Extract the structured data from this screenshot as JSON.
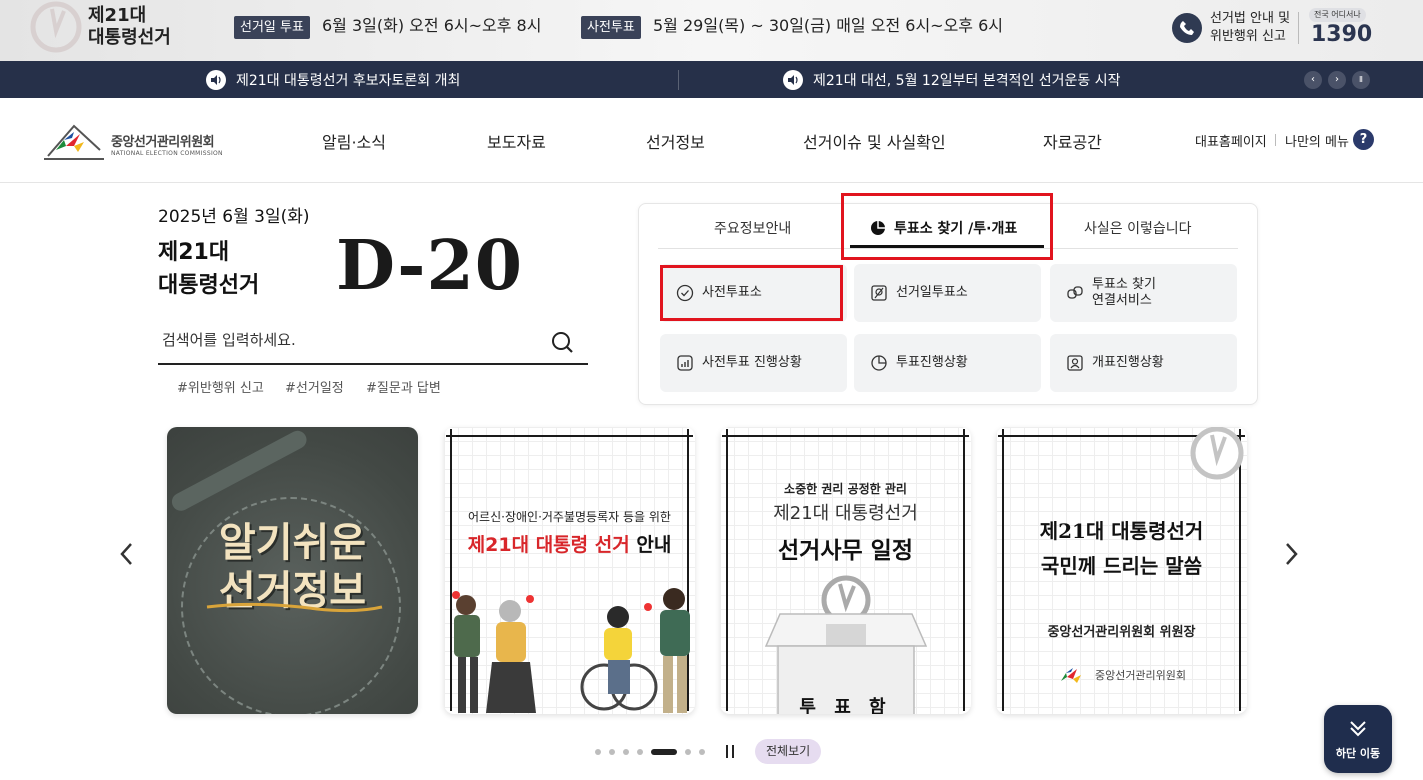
{
  "election_banner": {
    "title_line1": "제21대",
    "title_line2": "대통령선거",
    "election_day_tag": "선거일 투표",
    "election_day_date": "6월 3일(화) 오전 6시~오후 8시",
    "early_vote_tag": "사전투표",
    "early_vote_date": "5월 29일(목) ~ 30일(금) 매일 오전 6시~오후 6시",
    "law_guide_line1": "선거법 안내 및",
    "law_guide_line2": "위반행위 신고",
    "hotline_badge": "전국 어디서나",
    "hotline_number": "1390"
  },
  "ticker": {
    "items": [
      "제21대 대통령선거 후보자토론회 개최",
      "제21대 대선, 5월 12일부터 본격적인 선거운동 시작"
    ],
    "prev": "‹",
    "next": "›",
    "pause": "Ⅱ"
  },
  "header": {
    "logo_name": "중앙선거관리위원회",
    "logo_en": "NATIONAL ELECTION COMMISSION",
    "nav": [
      "알림·소식",
      "보도자료",
      "선거정보",
      "선거이슈 및 사실확인",
      "자료공간"
    ],
    "util_home": "대표홈페이지",
    "util_menu": "나만의 메뉴",
    "help": "?"
  },
  "hero": {
    "date": "2025년 6월 3일(화)",
    "title_line1": "제21대",
    "title_line2": "대통령선거",
    "dday": "D-20",
    "search_placeholder": "검색어를 입력하세요.",
    "tags": [
      "#위반행위 신고",
      "#선거일정",
      "#질문과 답변"
    ]
  },
  "panel": {
    "tabs": [
      "주요정보안내",
      "투표소 찾기 /투·개표",
      "사실은 이렇습니다"
    ],
    "active_tab": 1,
    "buttons": [
      {
        "label": "사전투표소",
        "icon": "check-circle-icon"
      },
      {
        "label": "선거일투표소",
        "icon": "ballot-icon"
      },
      {
        "label": "투표소 찾기\n연결서비스",
        "icon": "link-icon"
      },
      {
        "label": "사전투표 진행상황",
        "icon": "bar-chart-icon"
      },
      {
        "label": "투표진행상황",
        "icon": "pie-chart-icon"
      },
      {
        "label": "개표진행상황",
        "icon": "person-report-icon"
      }
    ]
  },
  "carousel": {
    "card1": {
      "title_line1": "알기쉬운",
      "title_line2": "선거정보"
    },
    "card2": {
      "subtitle": "어르신·장애인·거주불명등록자 등을 위한",
      "title_red": "제21대 대통령 선거",
      "title_black": "안내"
    },
    "card3": {
      "subtitle": "소중한 권리 공정한 관리",
      "title": "제21대 대통령선거",
      "headline": "선거사무 일정",
      "box_label": "투 표 함"
    },
    "card4": {
      "line1": "제21대 대통령선거",
      "line2": "국민께 드리는 말씀",
      "signer": "중앙선거관리위원회 위원장",
      "logo_text": "중앙선거관리위원회"
    },
    "dots": 7,
    "active_dot": 4,
    "view_all": "전체보기"
  },
  "float_button": {
    "label": "하단 이동"
  },
  "colors": {
    "navy": "#263049",
    "highlight_red": "#e1141e",
    "dday_text": "#1a1a1a",
    "viewall_bg": "#e6dcf0"
  }
}
